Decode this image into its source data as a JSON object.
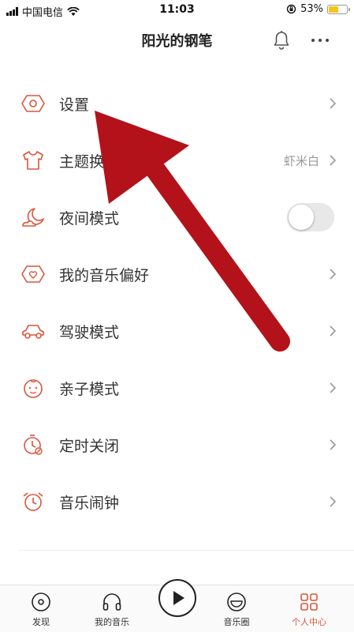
{
  "status_bar": {
    "carrier": "中国电信",
    "time": "11:03",
    "battery_percent": "53%",
    "battery_level": 0.53
  },
  "header": {
    "title": "阳光的钢笔",
    "icons": [
      "bell-icon",
      "more-icon"
    ]
  },
  "settings": [
    {
      "label": "设置",
      "icon": "settings-icon"
    },
    {
      "label": "主题换肤",
      "value": "虾米白",
      "icon": "shirt-icon"
    },
    {
      "label": "夜间模式",
      "icon": "moon-icon",
      "toggle": false
    },
    {
      "label": "我的音乐偏好",
      "icon": "preference-icon"
    },
    {
      "label": "驾驶模式",
      "icon": "car-icon"
    },
    {
      "label": "亲子模式",
      "icon": "baby-icon"
    },
    {
      "label": "定时关闭",
      "icon": "timer-icon"
    },
    {
      "label": "音乐闹钟",
      "icon": "alarm-icon"
    }
  ],
  "tabs": [
    {
      "label": "发现",
      "icon": "discover-icon"
    },
    {
      "label": "我的音乐",
      "icon": "headphones-icon"
    },
    {
      "label": "音乐圈",
      "icon": "music-circle-icon"
    },
    {
      "label": "个人中心",
      "icon": "profile-icon",
      "active": true
    }
  ],
  "colors": {
    "accent": "#d9573b",
    "arrow": "#b3121a",
    "toggle_off": "#e8e8e8"
  }
}
